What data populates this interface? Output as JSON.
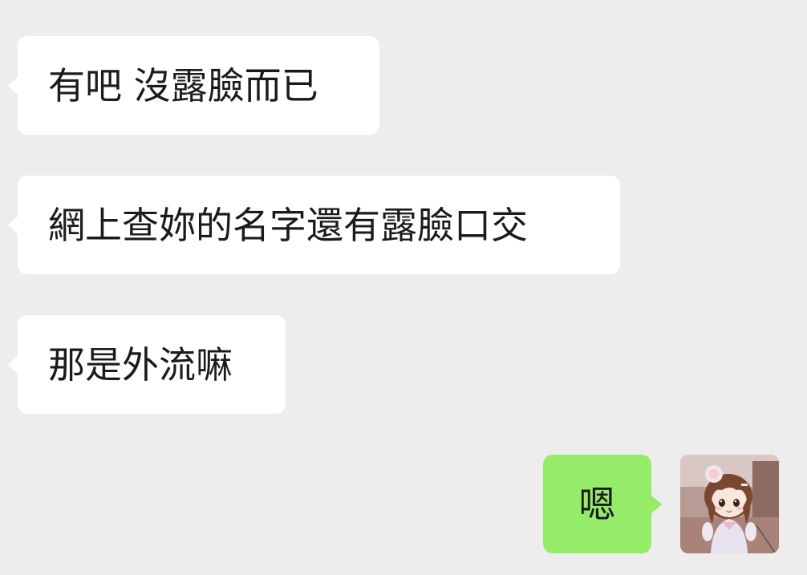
{
  "messages": [
    {
      "side": "incoming",
      "text": "有吧 沒露臉而已"
    },
    {
      "side": "incoming",
      "text": "網上查妳的名字還有露臉口交"
    },
    {
      "side": "incoming",
      "text": "那是外流嘛"
    },
    {
      "side": "outgoing",
      "text": "嗯"
    }
  ],
  "avatar": {
    "icon": "anime-girl-avatar-icon"
  },
  "colors": {
    "background": "#ededed",
    "incoming_bubble": "#ffffff",
    "outgoing_bubble": "#95ec69",
    "text": "#1b1b1b"
  }
}
